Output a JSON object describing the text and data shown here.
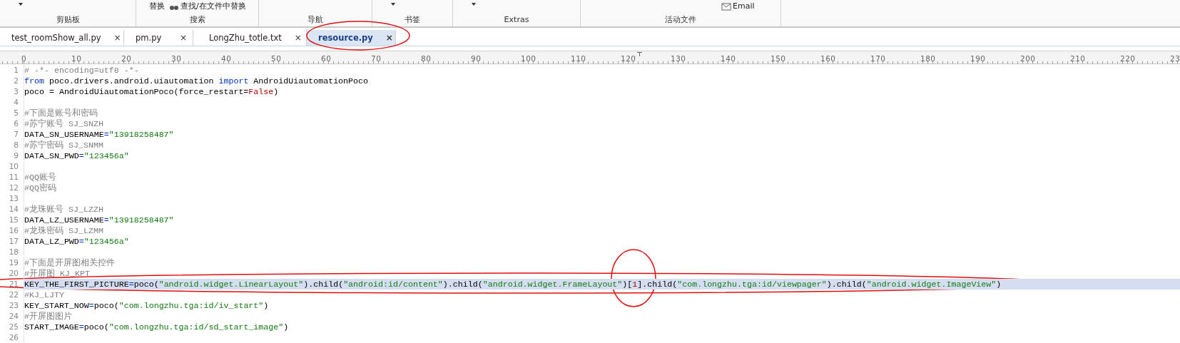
{
  "ribbon": {
    "groups": [
      {
        "label": "剪贴板",
        "items": [
          {
            "kind": "caret"
          }
        ]
      },
      {
        "label": "搜索",
        "items": [
          {
            "kind": "text",
            "text": "替换"
          },
          {
            "kind": "icon-text",
            "text": "查找/在文件中替换"
          }
        ]
      },
      {
        "label": "导航"
      },
      {
        "label": "书签",
        "items": [
          {
            "kind": "caret"
          }
        ]
      },
      {
        "label": "Extras",
        "items": [
          {
            "kind": "caret"
          }
        ]
      },
      {
        "label": "活动文件",
        "items": [
          {
            "kind": "icon-text",
            "text": "Email"
          }
        ]
      }
    ]
  },
  "tabs": [
    {
      "label": "test_roomShow_all.py",
      "selected": false,
      "kind": "plain",
      "close": "×"
    },
    {
      "label": "pm.py",
      "selected": false,
      "kind": "plain",
      "close": "×"
    },
    {
      "label": "LongZhu_totle.txt",
      "selected": false,
      "kind": "dot",
      "close": "×"
    },
    {
      "label": "resource.py",
      "selected": true,
      "kind": "diamond",
      "close": "×"
    }
  ],
  "ruler": [
    "0",
    "10",
    "20",
    "30",
    "40",
    "50",
    "60",
    "70",
    "80",
    "90",
    "100",
    "110",
    "120",
    "130",
    "140",
    "150",
    "160",
    "170",
    "180",
    "190",
    "200",
    "210",
    "220",
    "23"
  ],
  "editor": {
    "lines": [
      {
        "number": "1",
        "selected": false,
        "tokens": [
          {
            "kind": "comment",
            "text": "# -*- encoding=utf8 -*-"
          }
        ]
      },
      {
        "number": "2",
        "selected": false,
        "tokens": [
          {
            "kind": "keyword",
            "text": "from"
          },
          {
            "kind": "plain",
            "text": " poco.drivers.android.uiautomation "
          },
          {
            "kind": "keyword",
            "text": "import"
          },
          {
            "kind": "plain",
            "text": " AndroidUiautomationPoco"
          }
        ]
      },
      {
        "number": "3",
        "selected": false,
        "tokens": [
          {
            "kind": "plain",
            "text": "poco = AndroidUiautomationPoco(force_restart="
          },
          {
            "kind": "constant",
            "text": "False"
          },
          {
            "kind": "plain",
            "text": ")"
          }
        ]
      },
      {
        "number": "4",
        "selected": false
      },
      {
        "number": "5",
        "selected": false,
        "tokens": [
          {
            "kind": "comment",
            "text": "#下面是账号和密码"
          }
        ]
      },
      {
        "number": "6",
        "selected": false,
        "tokens": [
          {
            "kind": "comment",
            "text": "#苏宁账号 SJ_SNZH"
          }
        ]
      },
      {
        "number": "7",
        "selected": false,
        "tokens": [
          {
            "kind": "plain",
            "text": "DATA_SN_USERNAME"
          },
          {
            "kind": "operator",
            "text": "="
          },
          {
            "kind": "string",
            "text": "\"13918258487\""
          }
        ]
      },
      {
        "number": "8",
        "selected": false,
        "tokens": [
          {
            "kind": "comment",
            "text": "#苏宁密码 SJ_SNMM"
          }
        ]
      },
      {
        "number": "9",
        "selected": false,
        "tokens": [
          {
            "kind": "plain",
            "text": "DATA_SN_PWD"
          },
          {
            "kind": "operator",
            "text": "="
          },
          {
            "kind": "string",
            "text": "\"123456a\""
          }
        ]
      },
      {
        "number": "10",
        "selected": false
      },
      {
        "number": "11",
        "selected": false,
        "tokens": [
          {
            "kind": "comment",
            "text": "#QQ账号"
          }
        ]
      },
      {
        "number": "12",
        "selected": false,
        "tokens": [
          {
            "kind": "comment",
            "text": "#QQ密码"
          }
        ]
      },
      {
        "number": "13",
        "selected": false
      },
      {
        "number": "14",
        "selected": false,
        "tokens": [
          {
            "kind": "comment",
            "text": "#龙珠账号 SJ_LZZH"
          }
        ]
      },
      {
        "number": "15",
        "selected": false,
        "tokens": [
          {
            "kind": "plain",
            "text": "DATA_LZ_USERNAME"
          },
          {
            "kind": "operator",
            "text": "="
          },
          {
            "kind": "string",
            "text": "\"13918258487\""
          }
        ]
      },
      {
        "number": "16",
        "selected": false,
        "tokens": [
          {
            "kind": "comment",
            "text": "#龙珠密码 SJ_LZMM"
          }
        ]
      },
      {
        "number": "17",
        "selected": false,
        "tokens": [
          {
            "kind": "plain",
            "text": "DATA_LZ_PWD"
          },
          {
            "kind": "operator",
            "text": "="
          },
          {
            "kind": "string",
            "text": "\"123456a\""
          }
        ]
      },
      {
        "number": "18",
        "selected": false
      },
      {
        "number": "19",
        "selected": false,
        "tokens": [
          {
            "kind": "comment",
            "text": "#下面是开屏图相关控件"
          }
        ]
      },
      {
        "number": "20",
        "selected": false,
        "tokens": [
          {
            "kind": "comment",
            "text": "#开屏图 KJ_KPT"
          }
        ]
      },
      {
        "number": "21",
        "selected": true,
        "tokens": [
          {
            "kind": "plain",
            "text": "KEY_THE_FIRST_PICTURE"
          },
          {
            "kind": "operator",
            "text": "="
          },
          {
            "kind": "plain",
            "text": "poco("
          },
          {
            "kind": "string",
            "text": "\"android.widget.LinearLayout\""
          },
          {
            "kind": "plain",
            "text": ").child("
          },
          {
            "kind": "string",
            "text": "\"android:id/content\""
          },
          {
            "kind": "plain",
            "text": ").child("
          },
          {
            "kind": "string",
            "text": "\"android.widget.FrameLayout\""
          },
          {
            "kind": "plain",
            "text": ")["
          },
          {
            "kind": "constant",
            "text": "1"
          },
          {
            "kind": "plain",
            "text": "].child("
          },
          {
            "kind": "string",
            "text": "\"com.longzhu.tga:id/viewpager\""
          },
          {
            "kind": "plain",
            "text": ").child("
          },
          {
            "kind": "string",
            "text": "\"android.widget.ImageView\""
          },
          {
            "kind": "plain",
            "text": ")"
          }
        ]
      },
      {
        "number": "22",
        "selected": false,
        "tokens": [
          {
            "kind": "comment",
            "text": "#KJ_LJTY"
          }
        ]
      },
      {
        "number": "23",
        "selected": false,
        "tokens": [
          {
            "kind": "plain",
            "text": "KEY_START_NOW"
          },
          {
            "kind": "operator",
            "text": "="
          },
          {
            "kind": "plain",
            "text": "poco("
          },
          {
            "kind": "string",
            "text": "\"com.longzhu.tga:id/iv_start\""
          },
          {
            "kind": "plain",
            "text": ")"
          }
        ]
      },
      {
        "number": "24",
        "selected": false,
        "tokens": [
          {
            "kind": "comment",
            "text": "#开屏图图片"
          }
        ]
      },
      {
        "number": "25",
        "selected": false,
        "tokens": [
          {
            "kind": "plain",
            "text": "START_IMAGE"
          },
          {
            "kind": "operator",
            "text": "="
          },
          {
            "kind": "plain",
            "text": "poco("
          },
          {
            "kind": "string",
            "text": "\"com.longzhu.tga:id/sd_start_image\""
          },
          {
            "kind": "plain",
            "text": ")"
          }
        ]
      },
      {
        "number": "26",
        "selected": false
      }
    ]
  }
}
